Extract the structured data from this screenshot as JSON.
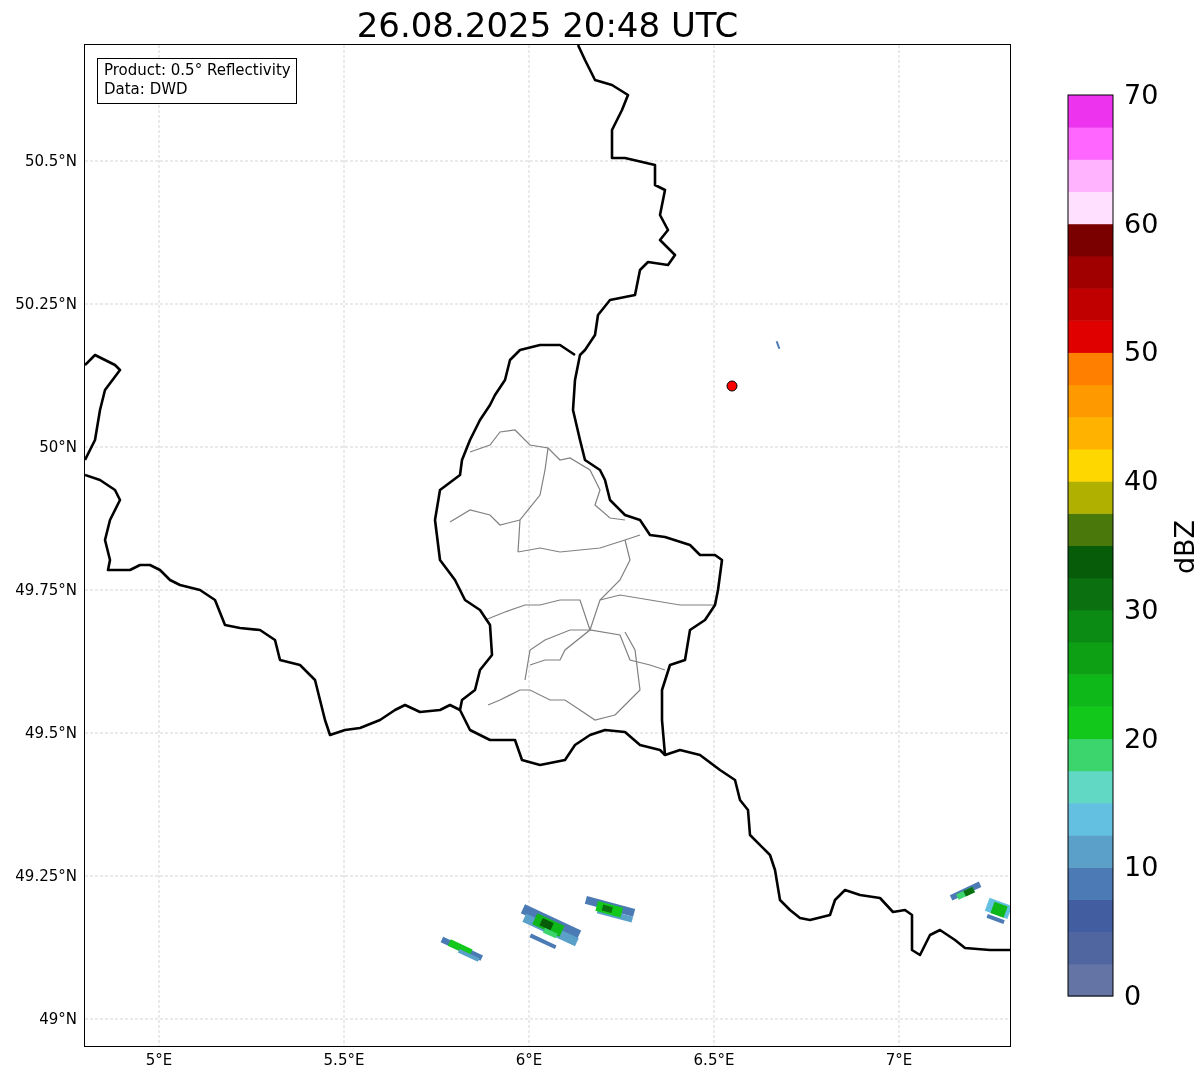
{
  "title": "26.08.2025 20:48 UTC",
  "info_box": {
    "lines": [
      "Product: 0.5° Reflectivity",
      "Data: DWD"
    ]
  },
  "map": {
    "lat_ticks": [
      "50.5°N",
      "50.25°N",
      "50°N",
      "49.75°N",
      "49.5°N",
      "49.25°N",
      "49°N"
    ],
    "lon_ticks": [
      "5°E",
      "5.5°E",
      "6°E",
      "6.5°E",
      "7°E"
    ]
  },
  "colorbar": {
    "label": "dBZ",
    "ticks": [
      "70",
      "60",
      "50",
      "40",
      "30",
      "20",
      "10",
      "0"
    ],
    "bands": [
      {
        "color": "#6474a4"
      },
      {
        "color": "#5066a0"
      },
      {
        "color": "#425ea0"
      },
      {
        "color": "#4b7ab4"
      },
      {
        "color": "#5aa0c8"
      },
      {
        "color": "#64c0e0"
      },
      {
        "color": "#60d8c4"
      },
      {
        "color": "#3cd46c"
      },
      {
        "color": "#12c81a"
      },
      {
        "color": "#0eb818"
      },
      {
        "color": "#0ea014"
      },
      {
        "color": "#0b8a14"
      },
      {
        "color": "#0a7010"
      },
      {
        "color": "#075c0a"
      },
      {
        "color": "#4a780a"
      },
      {
        "color": "#b0b000"
      },
      {
        "color": "#ffd700"
      },
      {
        "color": "#ffb300"
      },
      {
        "color": "#ff9900"
      },
      {
        "color": "#ff7f00"
      },
      {
        "color": "#e00000"
      },
      {
        "color": "#c00000"
      },
      {
        "color": "#a00000"
      },
      {
        "color": "#7a0000"
      },
      {
        "color": "#ffe0ff"
      },
      {
        "color": "#ffb3ff"
      },
      {
        "color": "#ff66ff"
      },
      {
        "color": "#ee33ee"
      }
    ]
  }
}
